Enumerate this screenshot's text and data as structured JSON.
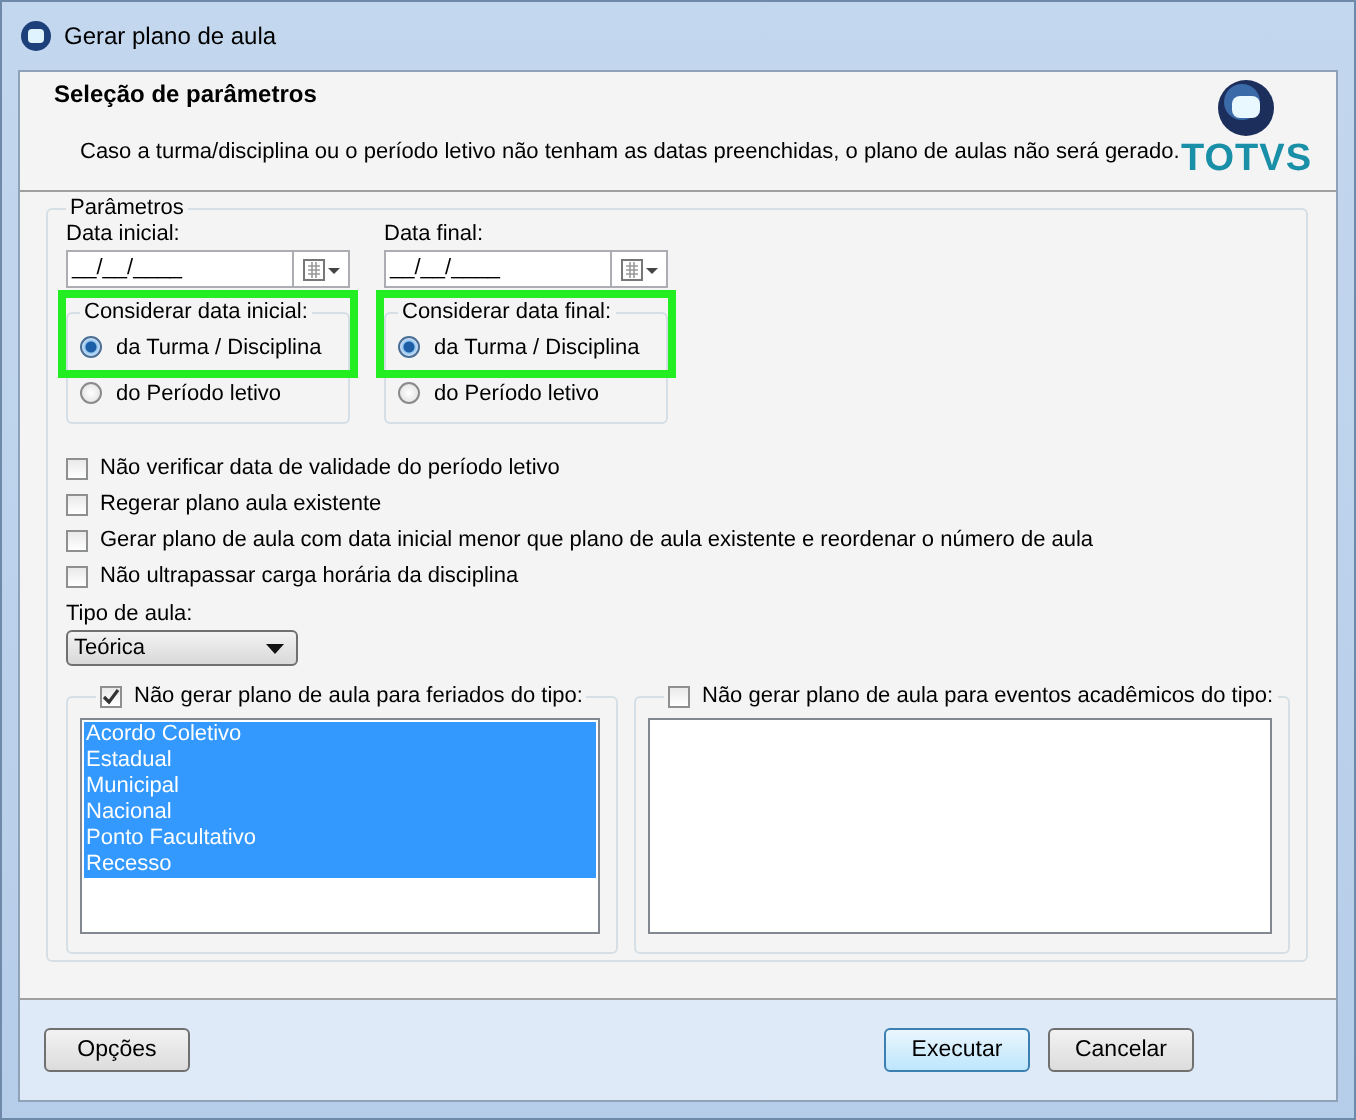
{
  "window": {
    "title": "Gerar plano de aula"
  },
  "header": {
    "title": "Seleção de parâmetros",
    "description": "Caso a turma/disciplina ou o período letivo não tenham as datas preenchidas, o plano de aulas não será gerado.",
    "logo": "TOTVS"
  },
  "parameters": {
    "title": "Parâmetros",
    "dates": [
      {
        "label": "Data inicial:",
        "value": "__/__/____",
        "consider": {
          "title": "Considerar data inicial:",
          "options": [
            {
              "label": "da Turma / Disciplina",
              "selected": true,
              "highlighted": true
            },
            {
              "label": "do Período letivo",
              "selected": false,
              "highlighted": false
            }
          ]
        }
      },
      {
        "label": "Data final:",
        "value": "__/__/____",
        "consider": {
          "title": "Considerar data final:",
          "options": [
            {
              "label": "da Turma / Disciplina",
              "selected": true,
              "highlighted": true
            },
            {
              "label": "do Período letivo",
              "selected": false,
              "highlighted": false
            }
          ]
        }
      }
    ],
    "checkboxes": [
      {
        "label": "Não verificar data de validade do período letivo",
        "checked": false
      },
      {
        "label": "Regerar plano aula existente",
        "checked": false
      },
      {
        "label": "Gerar plano de aula com data inicial menor que plano de aula existente e reordenar o número de aula",
        "checked": false
      },
      {
        "label": "Não ultrapassar carga horária da disciplina",
        "checked": false
      }
    ],
    "lesson_type": {
      "label": "Tipo de aula:",
      "value": "Teórica"
    },
    "exclusion_lists": [
      {
        "label": "Não gerar plano de aula para feriados do tipo:",
        "checked": true,
        "items": [
          {
            "label": "Acordo Coletivo",
            "selected": true
          },
          {
            "label": "Estadual",
            "selected": true
          },
          {
            "label": "Municipal",
            "selected": true
          },
          {
            "label": "Nacional",
            "selected": true
          },
          {
            "label": "Ponto Facultativo",
            "selected": true
          },
          {
            "label": "Recesso",
            "selected": true
          }
        ]
      },
      {
        "label": "Não gerar plano de aula para eventos acadêmicos do tipo:",
        "checked": false
      }
    ]
  },
  "footer": {
    "left_buttons": [
      {
        "label": "Opções",
        "default": false
      }
    ],
    "right_buttons": [
      {
        "label": "Executar",
        "default": true
      },
      {
        "label": "Cancelar",
        "default": false
      }
    ]
  }
}
